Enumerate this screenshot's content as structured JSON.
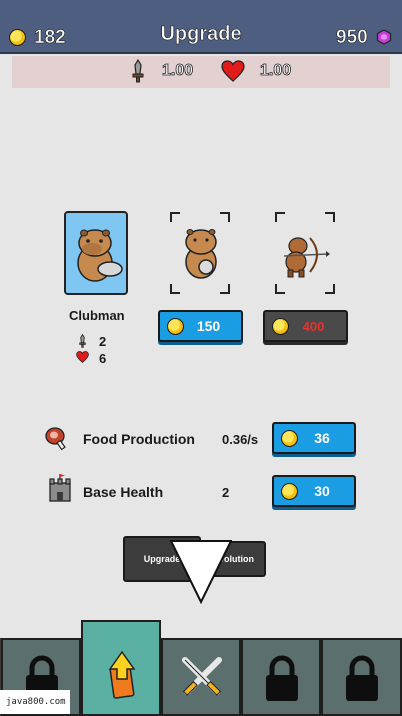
{
  "header": {
    "title": "Upgrade",
    "gold": "182",
    "gems": "950"
  },
  "stats": {
    "attack": "1.00",
    "health": "1.00"
  },
  "units": {
    "selected_name": "Clubman",
    "selected_attack": "2",
    "selected_health": "6",
    "unit2_price": "150",
    "unit3_price": "400"
  },
  "upgrades": [
    {
      "name": "Food Production",
      "value": "0.36/s",
      "price": "36"
    },
    {
      "name": "Base Health",
      "value": "2",
      "price": "30"
    }
  ],
  "tabs": {
    "left": "Upgrade",
    "right": "Evolution"
  },
  "watermark": "java800.com",
  "colors": {
    "topbar": "#4d5e80",
    "blue_button": "#1b9de4",
    "dark_button": "#4a4a4a",
    "price_red": "#e6322b",
    "nav_active": "#5ab0a3",
    "nav_slot": "#5b6f6f"
  },
  "icons": [
    "coin-icon",
    "gem-icon",
    "sword-icon",
    "heart-icon",
    "meat-icon",
    "castle-icon",
    "lock-icon",
    "upgrade-arrow-icon",
    "crossed-swords-icon"
  ]
}
